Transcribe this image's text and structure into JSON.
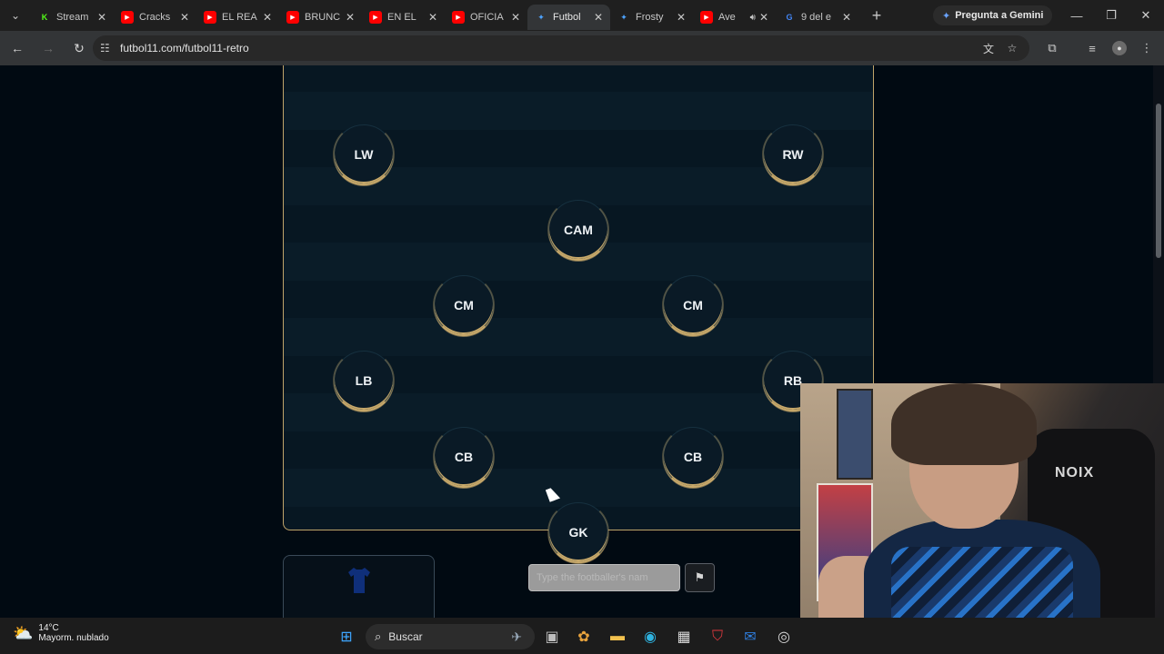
{
  "browser": {
    "tabs": [
      {
        "title": "Stream",
        "icon": "kick-icon",
        "color": "#53fc18",
        "active": false
      },
      {
        "title": "Cracks",
        "icon": "youtube-icon",
        "color": "#ff0000",
        "active": false
      },
      {
        "title": "EL REA",
        "icon": "youtube-icon",
        "color": "#ff0000",
        "active": false
      },
      {
        "title": "BRUNC",
        "icon": "youtube-icon",
        "color": "#ff0000",
        "active": false
      },
      {
        "title": "EN EL",
        "icon": "youtube-icon",
        "color": "#ff0000",
        "active": false
      },
      {
        "title": "OFICIA",
        "icon": "youtube-icon",
        "color": "#ff0000",
        "active": false
      },
      {
        "title": "Futbol",
        "icon": "futbol11-icon",
        "color": "#4da3ff",
        "active": true
      },
      {
        "title": "Frosty",
        "icon": "frosty-icon",
        "color": "#4da3ff",
        "active": false
      },
      {
        "title": "Ave",
        "icon": "youtube-icon",
        "color": "#ff0000",
        "active": false
      },
      {
        "title": "9 del e",
        "icon": "google-icon",
        "color": "#4285f4",
        "active": false
      }
    ],
    "gemini_label": "Pregunta a Gemini",
    "url": "futbol11.com/futbol11-retro"
  },
  "pitch": {
    "positions": [
      {
        "label": "LW"
      },
      {
        "label": "RW"
      },
      {
        "label": "CAM"
      },
      {
        "label": "CM"
      },
      {
        "label": "CM"
      },
      {
        "label": "LB"
      },
      {
        "label": "RB"
      },
      {
        "label": "CB"
      },
      {
        "label": "CB"
      },
      {
        "label": "GK"
      }
    ],
    "accent_color": "#c8a96a"
  },
  "bottom": {
    "kit_label": "...",
    "input_placeholder": "Type the footballer's nam"
  },
  "cam": {
    "chair_text": "NOIX"
  },
  "taskbar": {
    "weather_temp": "14°C",
    "weather_desc": "Mayorm. nublado",
    "search_label": "Buscar"
  }
}
